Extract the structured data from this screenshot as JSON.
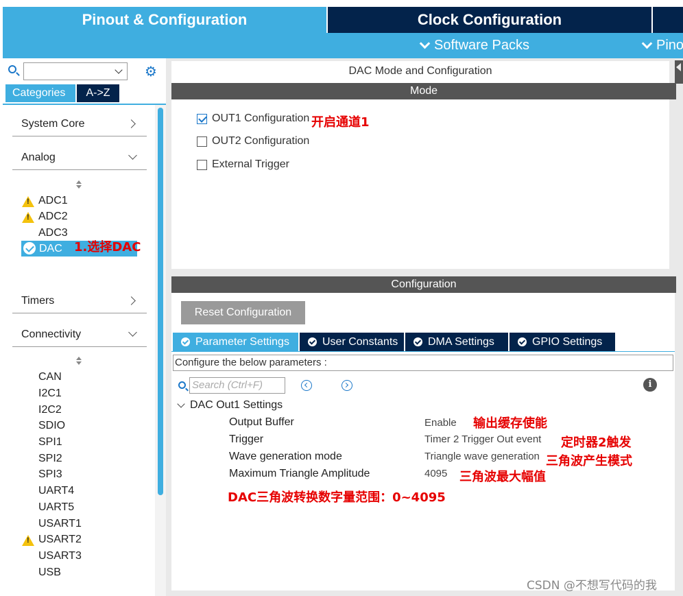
{
  "top_tabs": {
    "pinout": "Pinout & Configuration",
    "clock": "Clock Configuration"
  },
  "sub_menu": {
    "software_packs": "Software Packs",
    "pinout": "Pino"
  },
  "left": {
    "search_value": "",
    "tab_categories": "Categories",
    "tab_az": "A->Z",
    "categories": {
      "system_core": "System Core",
      "analog": "Analog",
      "timers": "Timers",
      "connectivity": "Connectivity"
    },
    "analog_items": [
      "ADC1",
      "ADC2",
      "ADC3",
      "DAC"
    ],
    "connectivity_items": [
      "CAN",
      "I2C1",
      "I2C2",
      "SDIO",
      "SPI1",
      "SPI2",
      "SPI3",
      "UART4",
      "UART5",
      "USART1",
      "USART2",
      "USART3",
      "USB"
    ]
  },
  "mode": {
    "title": "DAC Mode and Configuration",
    "bar": "Mode",
    "options": [
      {
        "label": "OUT1 Configuration",
        "checked": true
      },
      {
        "label": "OUT2 Configuration",
        "checked": false
      },
      {
        "label": "External Trigger",
        "checked": false
      }
    ]
  },
  "config": {
    "bar": "Configuration",
    "reset": "Reset Configuration",
    "tabs": [
      "Parameter Settings",
      "User Constants",
      "DMA Settings",
      "GPIO Settings"
    ],
    "hint": "Configure the below parameters :",
    "search_placeholder": "Search (Ctrl+F)",
    "info_glyph": "i",
    "group": "DAC Out1 Settings",
    "params": [
      {
        "name": "Output Buffer",
        "value": "Enable"
      },
      {
        "name": "Trigger",
        "value": "Timer 2 Trigger Out event"
      },
      {
        "name": "Wave generation mode",
        "value": "Triangle wave generation"
      },
      {
        "name": "Maximum Triangle Amplitude",
        "value": "4095"
      }
    ]
  },
  "annotations": {
    "select_dac": "1.选择DAC",
    "open_channel": "开启通道1",
    "output_buffer": "输出缓存使能",
    "trigger": "定时器2触发",
    "wave_mode": "三角波产生模式",
    "amplitude": "三角波最大幅值",
    "range": "DAC三角波转换数字量范围：0~4095"
  },
  "watermark": "CSDN @不想写代码的我",
  "colors": {
    "accent": "#3faee0",
    "dark_navy": "#03234b",
    "annotation_red": "#e60000"
  }
}
